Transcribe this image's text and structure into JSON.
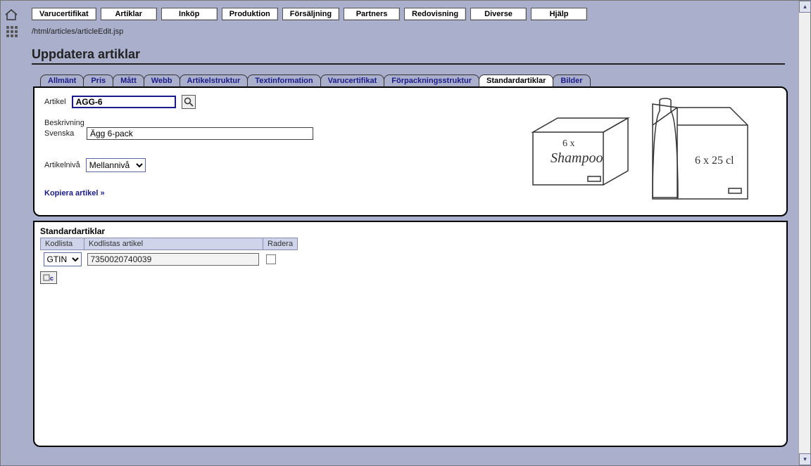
{
  "menu": [
    "Varucertifikat",
    "Artiklar",
    "Inköp",
    "Produktion",
    "Försäljning",
    "Partners",
    "Redovisning",
    "Diverse",
    "Hjälp"
  ],
  "breadcrumb": "/html/articles/articleEdit.jsp",
  "page_title": "Uppdatera artiklar",
  "tabs": [
    "Allmänt",
    "Pris",
    "Mått",
    "Webb",
    "Artikelstruktur",
    "Textinformation",
    "Varucertifikat",
    "Förpackningsstruktur",
    "Standardartiklar",
    "Bilder"
  ],
  "active_tab_index": 8,
  "form": {
    "article_label": "Artikel",
    "article_value": "AGG-6",
    "desc_heading": "Beskrivning",
    "desc_lang_label": "Svenska",
    "desc_value": "Ägg 6-pack",
    "level_label": "Artikelnivå",
    "level_value": "Mellannivå",
    "copy_link": "Kopiera artikel »"
  },
  "section": {
    "title": "Standardartiklar",
    "col_kodlista": "Kodlista",
    "col_kodlistas_artikel": "Kodlistas artikel",
    "col_radera": "Radera",
    "row": {
      "kodlista": "GTIN",
      "kodlistas_artikel": "7350020740039"
    }
  }
}
